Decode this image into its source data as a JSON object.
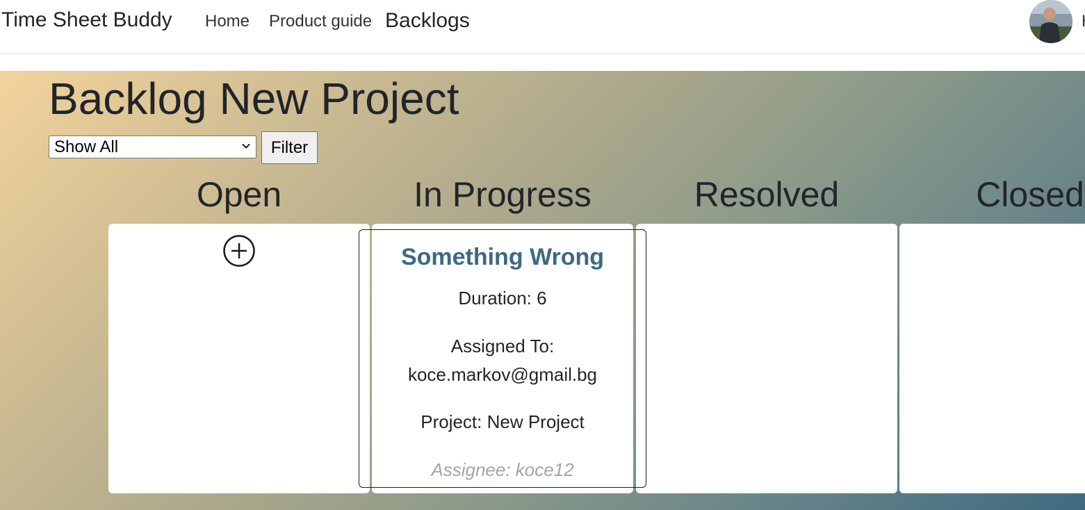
{
  "navbar": {
    "brand": "Time Sheet Buddy",
    "links": [
      "Home",
      "Product guide",
      "Backlogs"
    ],
    "greeting": "H"
  },
  "page": {
    "title": "Backlog New Project"
  },
  "filter": {
    "selected": "Show All",
    "button_label": "Filter"
  },
  "columns": [
    {
      "title": "Open"
    },
    {
      "title": "In Progress"
    },
    {
      "title": "Resolved"
    },
    {
      "title": "Closed"
    }
  ],
  "task": {
    "title": "Something Wrong",
    "duration": "Duration: 6",
    "assigned_to_label": "Assigned To:",
    "assigned_to_email": "koce.markov@gmail.bg",
    "project": "Project: New Project",
    "assignee": "Assignee: koce12"
  },
  "colors": {
    "task_title": "#3e6982",
    "assignee_text": "#a4a4a4",
    "gradient_start": "#f2d39c",
    "gradient_end": "#3f6a80"
  },
  "icons": {
    "add": "plus-circle-icon",
    "select": "chevron-down-icon",
    "avatar": "user-avatar"
  }
}
